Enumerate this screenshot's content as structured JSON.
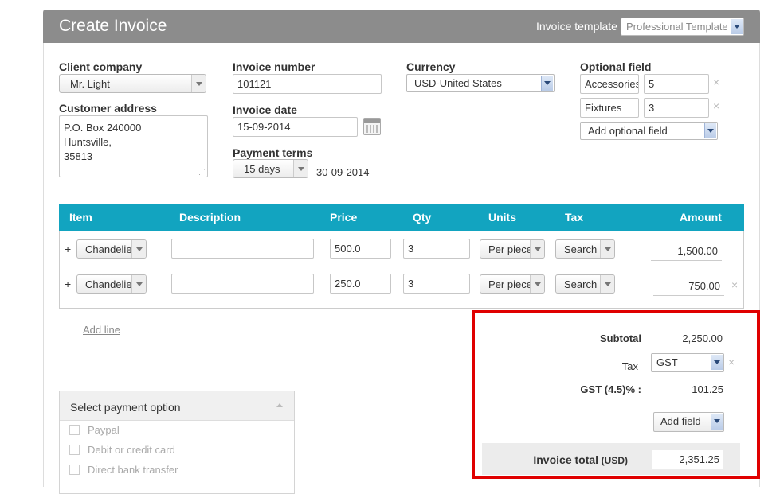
{
  "header": {
    "title": "Create Invoice",
    "template_label": "Invoice template",
    "template_value": "Professional Template"
  },
  "client": {
    "company_label": "Client company",
    "company_value": "Mr. Light",
    "address_label": "Customer address",
    "address_lines": [
      "P.O. Box 240000",
      "Huntsville,",
      "35813"
    ]
  },
  "invoice": {
    "number_label": "Invoice number",
    "number_value": "101121",
    "date_label": "Invoice date",
    "date_value": "15-09-2014",
    "terms_label": "Payment terms",
    "terms_value": "15 days",
    "due_date": "30-09-2014"
  },
  "currency": {
    "label": "Currency",
    "value": "USD-United States"
  },
  "optional": {
    "label": "Optional field",
    "fields": [
      {
        "name": "Accessories",
        "value": "5"
      },
      {
        "name": "Fixtures",
        "value": "3"
      }
    ],
    "add_label": "Add optional field"
  },
  "table": {
    "headers": {
      "item": "Item",
      "description": "Description",
      "price": "Price",
      "qty": "Qty",
      "units": "Units",
      "tax": "Tax",
      "amount": "Amount"
    },
    "rows": [
      {
        "plus": "+",
        "item": "Chandelier",
        "description": "",
        "price": "500.0",
        "qty": "3",
        "units": "Per piece",
        "tax": "Search",
        "amount": "1,500.00"
      },
      {
        "plus": "+",
        "item": "Chandelier",
        "description": "",
        "price": "250.0",
        "qty": "3",
        "units": "Per piece",
        "tax": "Search",
        "amount": "750.00"
      }
    ],
    "add_line": "Add line"
  },
  "payment": {
    "title": "Select payment option",
    "options": [
      "Paypal",
      "Debit or credit card",
      "Direct bank transfer"
    ]
  },
  "totals": {
    "subtotal_label": "Subtotal",
    "subtotal_value": "2,250.00",
    "tax_label": "Tax",
    "tax_value": "GST",
    "gst_label": "GST (4.5)% :",
    "gst_value": "101.25",
    "add_field": "Add field",
    "total_label": "Invoice total",
    "total_currency": "(USD)",
    "total_value": "2,351.25"
  },
  "icons": {
    "remove": "×",
    "close_icon": "close-icon",
    "calendar_icon": "calendar-icon"
  },
  "colors": {
    "header_bg": "#8c8c8c",
    "table_header_bg": "#12a4c0",
    "highlight_border": "#e00000"
  }
}
